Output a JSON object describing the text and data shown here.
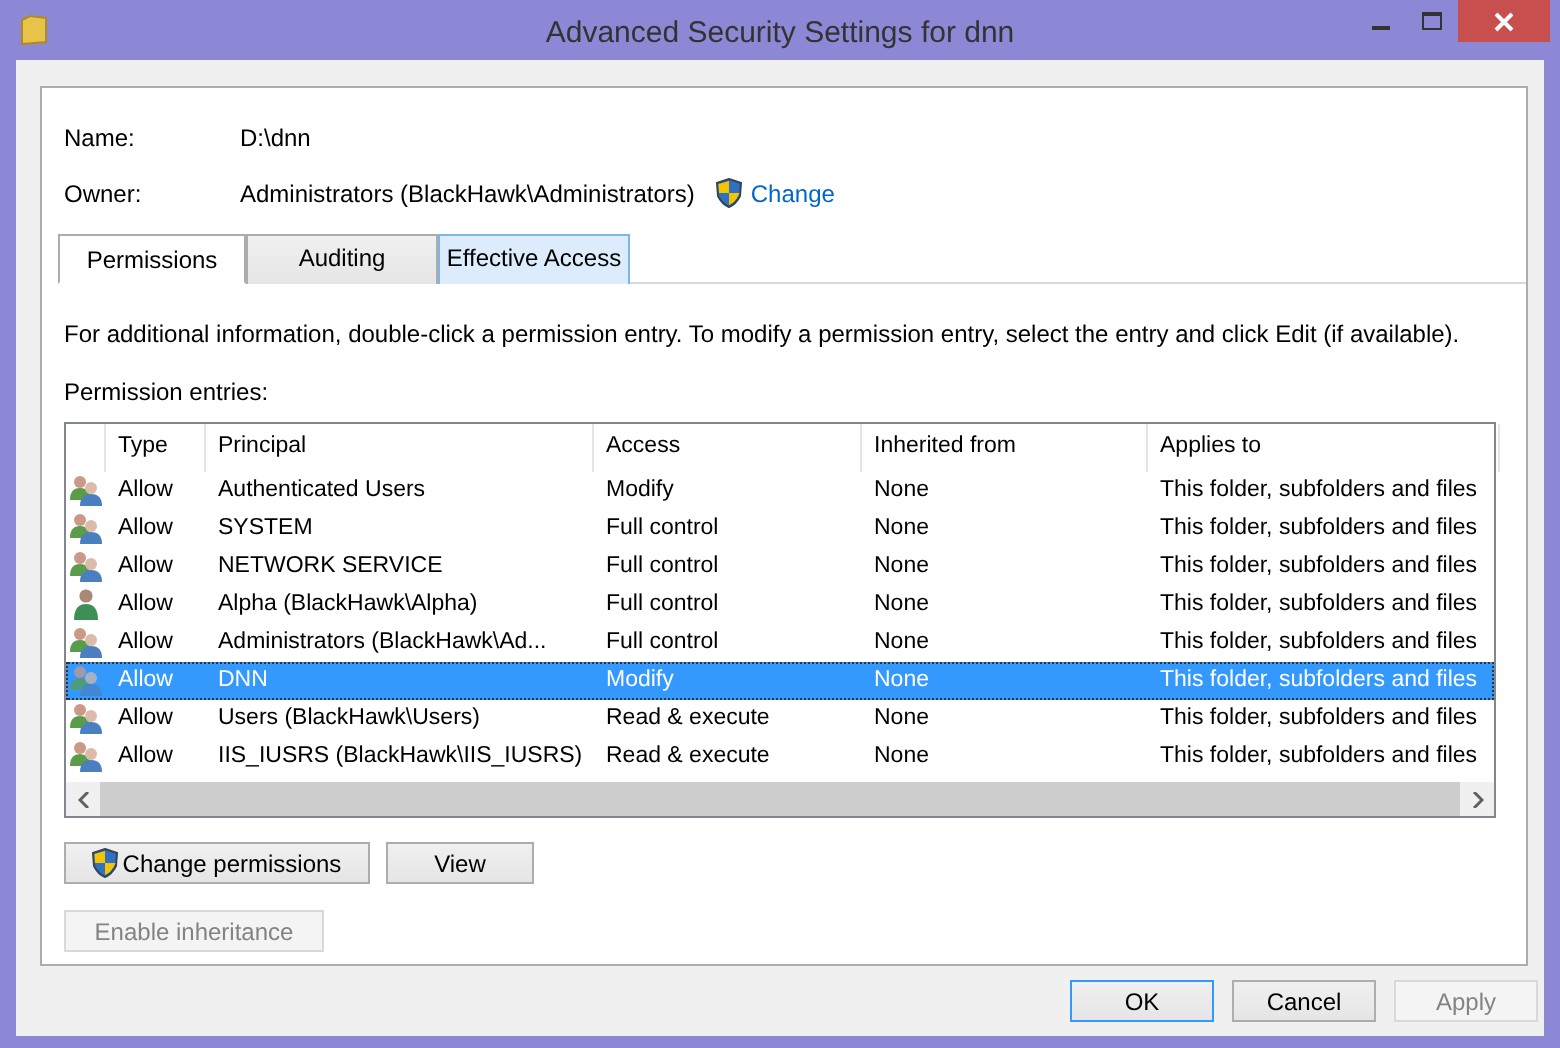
{
  "window": {
    "title": "Advanced Security Settings for dnn"
  },
  "name": {
    "label": "Name:",
    "value": "D:\\dnn"
  },
  "owner": {
    "label": "Owner:",
    "value": "Administrators (BlackHawk\\Administrators)",
    "link": "Change"
  },
  "tabs": [
    {
      "label": "Permissions",
      "selected": true,
      "hovered": false
    },
    {
      "label": "Auditing",
      "selected": false,
      "hovered": false
    },
    {
      "label": "Effective Access",
      "selected": false,
      "hovered": true
    }
  ],
  "info": "For additional information, double-click a permission entry. To modify a permission entry, select the entry and click Edit (if available).",
  "entries_label": "Permission entries:",
  "table": {
    "columns": [
      "Type",
      "Principal",
      "Access",
      "Inherited from",
      "Applies to"
    ],
    "rows": [
      {
        "kind": "group",
        "selected": false,
        "cells": [
          "Allow",
          "Authenticated Users",
          "Modify",
          "None",
          "This folder, subfolders and files"
        ]
      },
      {
        "kind": "group",
        "selected": false,
        "cells": [
          "Allow",
          "SYSTEM",
          "Full control",
          "None",
          "This folder, subfolders and files"
        ]
      },
      {
        "kind": "group",
        "selected": false,
        "cells": [
          "Allow",
          "NETWORK SERVICE",
          "Full control",
          "None",
          "This folder, subfolders and files"
        ]
      },
      {
        "kind": "user",
        "selected": false,
        "cells": [
          "Allow",
          "Alpha (BlackHawk\\Alpha)",
          "Full control",
          "None",
          "This folder, subfolders and files"
        ]
      },
      {
        "kind": "group",
        "selected": false,
        "cells": [
          "Allow",
          "Administrators (BlackHawk\\Ad...",
          "Full control",
          "None",
          "This folder, subfolders and files"
        ]
      },
      {
        "kind": "group",
        "selected": true,
        "cells": [
          "Allow",
          "DNN",
          "Modify",
          "None",
          "This folder, subfolders and files"
        ]
      },
      {
        "kind": "group",
        "selected": false,
        "cells": [
          "Allow",
          "Users (BlackHawk\\Users)",
          "Read & execute",
          "None",
          "This folder, subfolders and files"
        ]
      },
      {
        "kind": "group",
        "selected": false,
        "cells": [
          "Allow",
          "IIS_IUSRS (BlackHawk\\IIS_IUSRS)",
          "Read & execute",
          "None",
          "This folder, subfolders and files"
        ]
      }
    ]
  },
  "actions": [
    {
      "label": "Change permissions",
      "shield": true
    },
    {
      "label": "View",
      "shield": false
    }
  ],
  "inheritance_button": {
    "label": "Enable inheritance",
    "disabled": true
  },
  "footer_buttons": [
    {
      "label": "OK",
      "default": true,
      "disabled": false
    },
    {
      "label": "Cancel",
      "default": false,
      "disabled": false
    },
    {
      "label": "Apply",
      "default": false,
      "disabled": true
    }
  ]
}
